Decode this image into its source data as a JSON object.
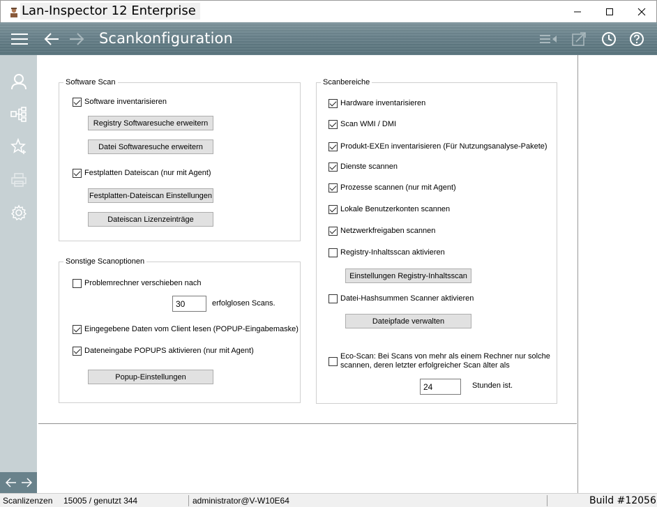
{
  "window": {
    "title": "Lan-Inspector 12 Enterprise",
    "minimize_icon": "minimize-icon",
    "maximize_icon": "maximize-icon",
    "close_icon": "close-icon"
  },
  "header": {
    "title": "Scankonfiguration",
    "accent_color": "#5f7982"
  },
  "software_scan": {
    "legend": "Software Scan",
    "inventory_label": "Software inventarisieren",
    "inventory_checked": true,
    "registry_button": "Registry Softwaresuche erweitern",
    "file_button": "Datei Softwaresuche erweitern",
    "disk_scan_label": "Festplatten Dateiscan (nur mit Agent)",
    "disk_scan_checked": true,
    "disk_settings_button": "Festplatten-Dateiscan Einstellungen",
    "license_button": "Dateiscan Lizenzeinträge"
  },
  "other_options": {
    "legend": "Sonstige Scanoptionen",
    "postpone_label": "Problemrechner verschieben nach",
    "postpone_checked": false,
    "postpone_value": "30",
    "postpone_suffix": "erfolglosen Scans.",
    "client_data_label": "Eingegebene Daten vom Client lesen (POPUP-Eingabemaske)",
    "client_data_checked": true,
    "popups_label": "Dateneingabe POPUPS aktivieren (nur mit Agent)",
    "popups_checked": true,
    "popup_settings_button": "Popup-Einstellungen"
  },
  "scan_areas": {
    "legend": "Scanbereiche",
    "items": [
      {
        "label": "Hardware inventarisieren",
        "checked": true
      },
      {
        "label": "Scan WMI / DMI",
        "checked": true
      },
      {
        "label": "Produkt-EXEn inventarisieren (Für Nutzungsanalyse-Pakete)",
        "checked": true
      },
      {
        "label": "Dienste scannen",
        "checked": true
      },
      {
        "label": "Prozesse scannen (nur mit Agent)",
        "checked": true
      },
      {
        "label": "Lokale Benutzerkonten scannen",
        "checked": true
      },
      {
        "label": "Netzwerkfreigaben scannen",
        "checked": true
      },
      {
        "label": "Registry-Inhaltsscan aktivieren",
        "checked": false
      }
    ],
    "registry_settings_button": "Einstellungen Registry-Inhaltsscan",
    "hash_label": "Datei-Hashsummen Scanner aktivieren",
    "hash_checked": false,
    "filepaths_button": "Dateipfade verwalten",
    "eco_label_line1": "Eco-Scan: Bei Scans von mehr als einem Rechner nur solche",
    "eco_label_line2": "scannen, deren letzter erfolgreicher Scan älter als",
    "eco_checked": false,
    "eco_value": "24",
    "eco_suffix": "Stunden ist."
  },
  "statusbar": {
    "licenses_label": "Scanlizenzen",
    "licenses_value": "15005 / genutzt 344",
    "user": "administrator@V-W10E64",
    "build": "Build #12056"
  }
}
